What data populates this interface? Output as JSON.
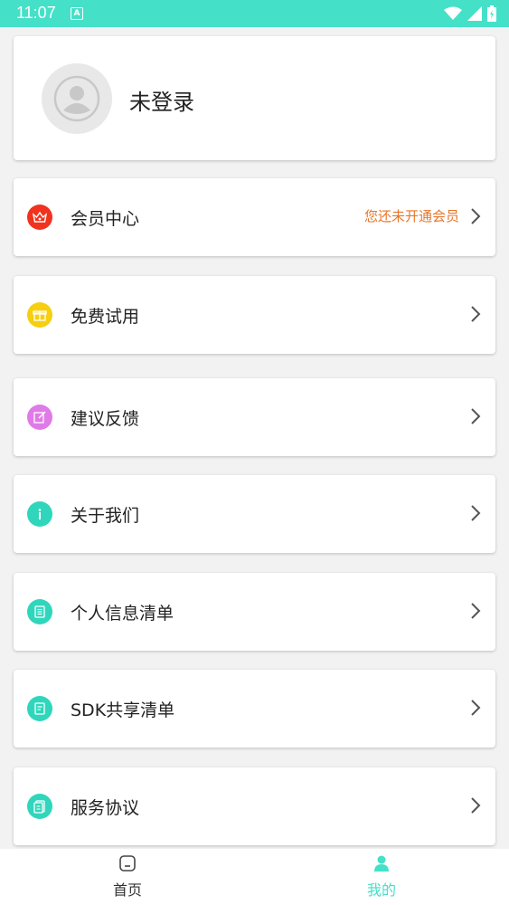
{
  "status_bar": {
    "time": "11:07",
    "notification_letter": "A",
    "icons": [
      "wifi-icon",
      "signal-icon",
      "battery-icon"
    ]
  },
  "profile": {
    "name": "未登录",
    "avatar_icon": "default-avatar-icon"
  },
  "menu": {
    "items": [
      {
        "label": "会员中心",
        "sub": "您还未开通会员",
        "icon": "crown-icon",
        "color": "#f0321e"
      },
      {
        "label": "免费试用",
        "icon": "gift-icon",
        "color": "#f5cf10"
      },
      {
        "label": "建议反馈",
        "icon": "edit-icon",
        "color": "#e07ae8"
      },
      {
        "label": "关于我们",
        "icon": "info-icon",
        "color": "#2fd6bc"
      },
      {
        "label": "个人信息清单",
        "icon": "list-icon",
        "color": "#2fd6bc"
      },
      {
        "label": "SDK共享清单",
        "icon": "document-icon",
        "color": "#2fd6bc"
      },
      {
        "label": "服务协议",
        "icon": "agreement-icon",
        "color": "#2fd6bc"
      }
    ]
  },
  "tabbar": {
    "home_label": "首页",
    "mine_label": "我的",
    "active_color": "#45e0c8",
    "inactive_color": "#333333"
  },
  "colors": {
    "accent": "#45e0c8",
    "vip_text": "#e8752a"
  }
}
